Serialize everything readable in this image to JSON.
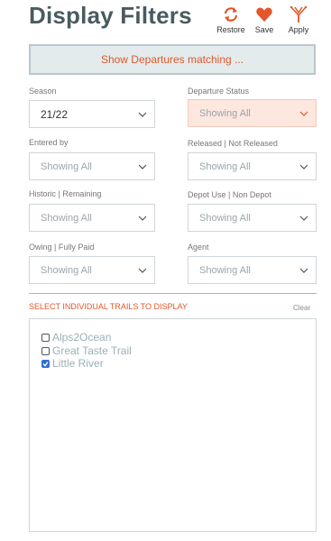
{
  "header": {
    "title": "Display Filters",
    "actions": [
      {
        "label": "Restore",
        "icon": "restore-icon"
      },
      {
        "label": "Save",
        "icon": "heart-icon"
      },
      {
        "label": "Apply",
        "icon": "filter-apply-icon"
      }
    ]
  },
  "banner": {
    "text": "Show Departures matching ..."
  },
  "filters": {
    "season": {
      "label": "Season",
      "value": "21/22"
    },
    "departure_status": {
      "label": "Departure Status",
      "value": "Showing All"
    },
    "entered_by": {
      "label": "Entered by",
      "value": "Showing All"
    },
    "released": {
      "label": "Released | Not Released",
      "value": "Showing All"
    },
    "historic": {
      "label": "Historic | Remaining",
      "value": "Showing All"
    },
    "depot_use": {
      "label": "Depot Use | Non Depot",
      "value": "Showing All"
    },
    "owing": {
      "label": "Owing | Fully Paid",
      "value": "Showing All"
    },
    "agent": {
      "label": "Agent",
      "value": "Showing All"
    }
  },
  "trails": {
    "heading": "SELECT INDIVIDUAL TRAILS TO DISPLAY",
    "clear_label": "Clear",
    "items": [
      {
        "label": "Alps2Ocean",
        "checked": false
      },
      {
        "label": "Great Taste Trail",
        "checked": false
      },
      {
        "label": "Little River",
        "checked": true
      }
    ]
  },
  "colors": {
    "accent": "#e2572a",
    "title": "#4a5a61",
    "banner_bg": "#e4ebed",
    "status_bg": "#fde7de",
    "trail_text": "#9cb0b6"
  }
}
